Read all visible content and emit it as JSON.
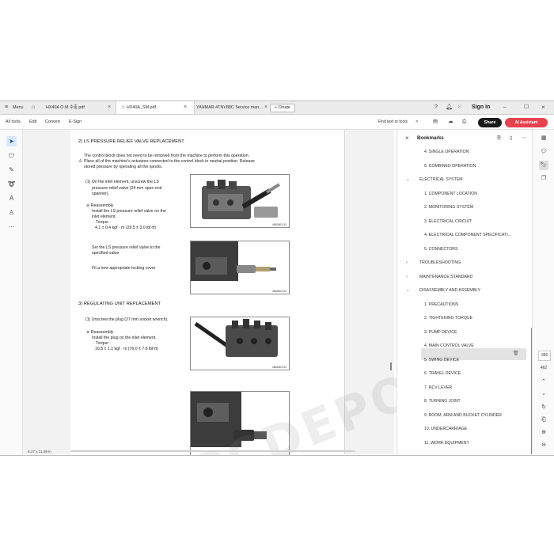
{
  "tabs": {
    "menu_label": "Menu",
    "items": [
      {
        "label": "HX40A O.M 수출.pdf"
      },
      {
        "label": "HX40A_SM.pdf"
      },
      {
        "label": "YANMAR 4TNV88C Service man..."
      }
    ],
    "create_label": "+ Create",
    "signin_label": "Sign in"
  },
  "toolbar": {
    "menus": [
      "All tools",
      "Edit",
      "Convert",
      "E-Sign"
    ],
    "find_label": "Find text or tools",
    "share_label": "Share",
    "ai_label": "AI Assistant"
  },
  "document": {
    "section2_title": "2) LS PRESSURE RELIEF VALVE REPLACEMENT",
    "intro_line1": "The control block does not need to be removed from the machine to perform this operation.",
    "intro_line2": "Place all of the machine's actuators connected to the control block in neutral position. Release",
    "intro_line3": "stored pressure by operating all the spools.",
    "step1_line1": "(1)  On the inlet element, unscrew the LS",
    "step1_line2": "pressure relief valve (24 mm open end",
    "step1_line3": "spanner).",
    "reassembly_label": "※  Reassembly",
    "re1_line1": "Install the LS pressure relief valve on the",
    "re1_line2": "inlet element.",
    "torque_label": "· Torque :",
    "torque1_value": "4.1 ± 0.4 kgf · m (29.5 ± 3.0 lbf·ft)",
    "setvalve_line1": "Set the LS pressure relief valve to the",
    "setvalve_line2": "specified value",
    "cover_line": "Fit a new appropriate locking cover",
    "section3_title": "3) REGULATING UNIT REPLACEMENT",
    "step3_line": "(1)  Unscrew the plug (27 mm socket wrench).",
    "re2_line1": "Install the plug on the inlet element.",
    "torque2_value": "10.5 ± 1.1 kgf · m (76.0 ± 7.6 lbf·ft)",
    "fig_captions": [
      "48A2MCV13",
      "48A2MCV13",
      "48A2MCV14"
    ],
    "watermark": "EPCDEPO.COM",
    "page_size": "8,27 x 11,69 in"
  },
  "bookmarks": {
    "title": "Bookmarks",
    "items": [
      {
        "label": "4. SINGLE OPERATION",
        "level": 2
      },
      {
        "label": "5. COMBINED OPERATION",
        "level": 2
      },
      {
        "label": "ELECTRICAL SYSTEM",
        "level": 1,
        "expanded": true
      },
      {
        "label": "1. COMPONENT LOCATION",
        "level": 2
      },
      {
        "label": "2. MONITORING SYSTEM",
        "level": 2
      },
      {
        "label": "3. ELECTRICAL CIRCUIT",
        "level": 2
      },
      {
        "label": "4. ELECTRICAL COMPONENT SPECIFICATI...",
        "level": 2
      },
      {
        "label": "5. CONNECTORS",
        "level": 2
      },
      {
        "label": "TROUBLESHOOTING",
        "level": 1,
        "expanded": false
      },
      {
        "label": "MAINTENANCE STANDARD",
        "level": 1,
        "expanded": false
      },
      {
        "label": "DISASSEMBLY AND ASSEMBLY",
        "level": 1,
        "expanded": true
      },
      {
        "label": "1. PRECAUTIONS",
        "level": 2
      },
      {
        "label": "2. TIGHTENING TORQUE",
        "level": 2
      },
      {
        "label": "3. PUMP DEVICE",
        "level": 2
      },
      {
        "label": "4. MAIN CONTROL VALVE",
        "level": 2,
        "selected": true
      },
      {
        "label": "5. SWING DEVICE",
        "level": 2
      },
      {
        "label": "6. TRAVEL DEVICE",
        "level": 2
      },
      {
        "label": "7. RCV LEVER",
        "level": 2
      },
      {
        "label": "8. TURNING JOINT",
        "level": 2
      },
      {
        "label": "9. BOOM, ARM AND BUCKET CYLINDER",
        "level": 2
      },
      {
        "label": "10. UNDERCARRIAGE",
        "level": 2
      },
      {
        "label": "11. WORK EQUIPMENT",
        "level": 2
      }
    ]
  },
  "pagenav": {
    "current": "356",
    "total": "462"
  },
  "colors": {
    "share_bg": "#1a1a1a",
    "ai_bg": "#e8424f",
    "accent_blue": "#1473e6",
    "selected_row": "#e3e3e3"
  }
}
